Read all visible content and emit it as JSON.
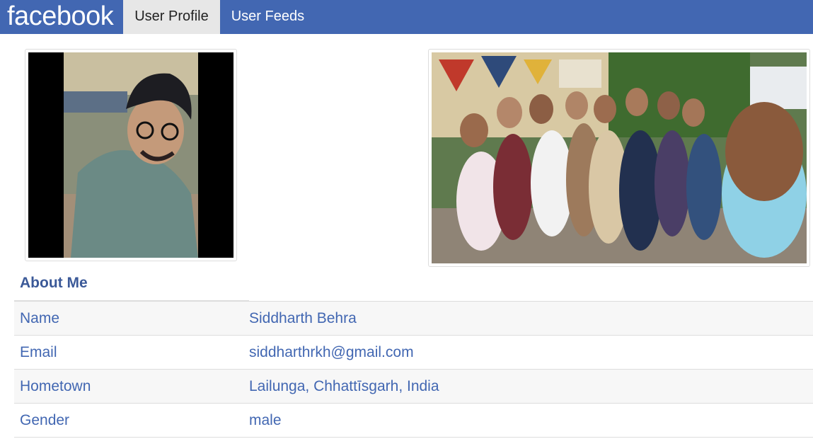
{
  "navbar": {
    "brand": "facebook",
    "tabs": [
      {
        "label": "User Profile",
        "active": true
      },
      {
        "label": "User Feeds",
        "active": false
      }
    ]
  },
  "profile_photo": {
    "description_icon": "profile-photo"
  },
  "cover_photo": {
    "description_icon": "group-photo"
  },
  "about": {
    "title": "About Me",
    "rows": [
      {
        "label": "Name",
        "value": "Siddharth Behra"
      },
      {
        "label": "Email",
        "value": "siddharthrkh@gmail.com"
      },
      {
        "label": "Hometown",
        "value": "Lailunga, Chhattīsgarh, India"
      },
      {
        "label": "Gender",
        "value": "male"
      }
    ]
  },
  "colors": {
    "navbar": "#4267b2",
    "active_tab": "#e7e7e7",
    "text_blue": "#4267b2"
  }
}
